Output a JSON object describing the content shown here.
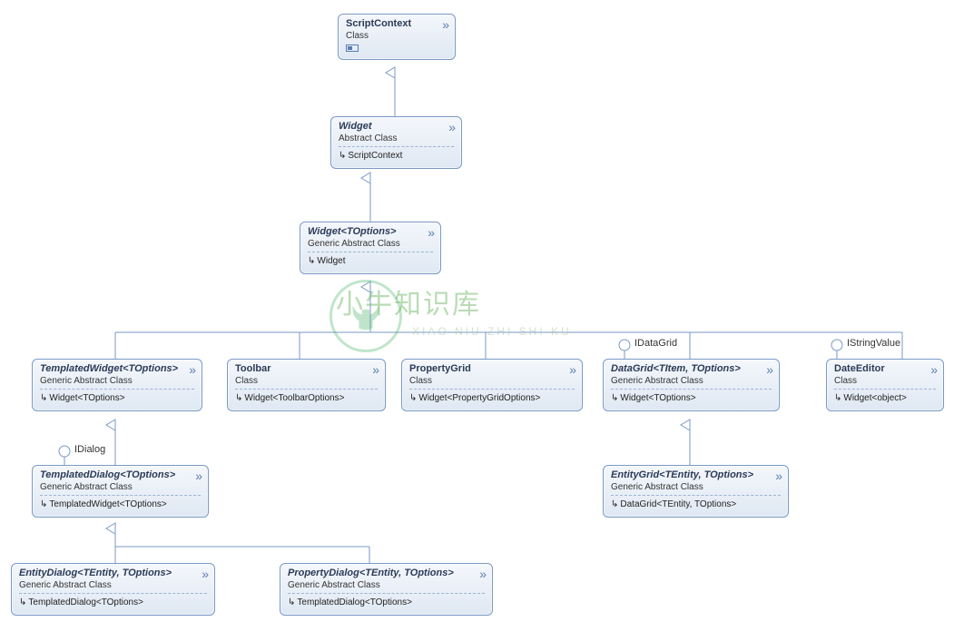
{
  "watermark": {
    "title": "小牛知识库",
    "subtitle": "XIAO NIU ZHI SHI KU"
  },
  "interfaces": {
    "iDialog": "IDialog",
    "iDataGrid": "IDataGrid",
    "iStringValue": "IStringValue"
  },
  "boxes": {
    "scriptContext": {
      "title": "ScriptContext",
      "type": "Class"
    },
    "widget": {
      "title": "Widget",
      "type": "Abstract Class",
      "base": "ScriptContext"
    },
    "widgetT": {
      "title": "Widget<TOptions>",
      "type": "Generic Abstract Class",
      "base": "Widget"
    },
    "templatedWidget": {
      "title": "TemplatedWidget<TOptions>",
      "type": "Generic Abstract Class",
      "base": "Widget<TOptions>"
    },
    "toolbar": {
      "title": "Toolbar",
      "type": "Class",
      "base": "Widget<ToolbarOptions>"
    },
    "propertyGrid": {
      "title": "PropertyGrid",
      "type": "Class",
      "base": "Widget<PropertyGridOptions>"
    },
    "dataGrid": {
      "title": "DataGrid<TItem, TOptions>",
      "type": "Generic Abstract Class",
      "base": "Widget<TOptions>"
    },
    "dateEditor": {
      "title": "DateEditor",
      "type": "Class",
      "base": "Widget<object>"
    },
    "templatedDialog": {
      "title": "TemplatedDialog<TOptions>",
      "type": "Generic Abstract Class",
      "base": "TemplatedWidget<TOptions>"
    },
    "entityGrid": {
      "title": "EntityGrid<TEntity, TOptions>",
      "type": "Generic Abstract Class",
      "base": "DataGrid<TEntity, TOptions>"
    },
    "entityDialog": {
      "title": "EntityDialog<TEntity, TOptions>",
      "type": "Generic Abstract Class",
      "base": "TemplatedDialog<TOptions>"
    },
    "propertyDialog": {
      "title": "PropertyDialog<TEntity, TOptions>",
      "type": "Generic Abstract Class",
      "base": "TemplatedDialog<TOptions>"
    }
  }
}
